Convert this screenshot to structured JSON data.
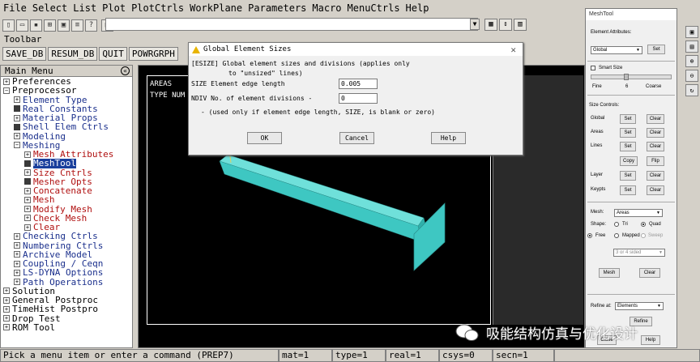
{
  "menubar": [
    "File",
    "Select",
    "List",
    "Plot",
    "PlotCtrls",
    "WorkPlane",
    "Parameters",
    "Macro",
    "MenuCtrls",
    "Help"
  ],
  "toolbar": {
    "label": "Toolbar",
    "buttons": [
      "SAVE_DB",
      "RESUM_DB",
      "QUIT",
      "POWRGRPH"
    ]
  },
  "main_menu": {
    "title": "Main Menu",
    "items": [
      {
        "label": "Preferences",
        "marker": "plus",
        "level": 0,
        "style": "black"
      },
      {
        "label": "Preprocessor",
        "marker": "minus",
        "level": 0,
        "style": "black"
      },
      {
        "label": "Element Type",
        "marker": "plus",
        "level": 1,
        "style": "blue"
      },
      {
        "label": "Real Constants",
        "marker": "block",
        "level": 1,
        "style": "blue"
      },
      {
        "label": "Material Props",
        "marker": "plus",
        "level": 1,
        "style": "blue"
      },
      {
        "label": "Shell Elem Ctrls",
        "marker": "block",
        "level": 1,
        "style": "blue"
      },
      {
        "label": "Modeling",
        "marker": "plus",
        "level": 1,
        "style": "blue"
      },
      {
        "label": "Meshing",
        "marker": "minus",
        "level": 1,
        "style": "blue"
      },
      {
        "label": "Mesh Attributes",
        "marker": "plus",
        "level": 2,
        "style": "red"
      },
      {
        "label": "MeshTool",
        "marker": "block",
        "level": 2,
        "style": "selected"
      },
      {
        "label": "Size Cntrls",
        "marker": "plus",
        "level": 2,
        "style": "red"
      },
      {
        "label": "Mesher Opts",
        "marker": "block",
        "level": 2,
        "style": "red"
      },
      {
        "label": "Concatenate",
        "marker": "plus",
        "level": 2,
        "style": "red"
      },
      {
        "label": "Mesh",
        "marker": "plus",
        "level": 2,
        "style": "red"
      },
      {
        "label": "Modify Mesh",
        "marker": "plus",
        "level": 2,
        "style": "red"
      },
      {
        "label": "Check Mesh",
        "marker": "plus",
        "level": 2,
        "style": "red"
      },
      {
        "label": "Clear",
        "marker": "plus",
        "level": 2,
        "style": "red"
      },
      {
        "label": "Checking Ctrls",
        "marker": "plus",
        "level": 1,
        "style": "blue"
      },
      {
        "label": "Numbering Ctrls",
        "marker": "plus",
        "level": 1,
        "style": "blue"
      },
      {
        "label": "Archive Model",
        "marker": "plus",
        "level": 1,
        "style": "blue"
      },
      {
        "label": "Coupling / Ceqn",
        "marker": "plus",
        "level": 1,
        "style": "blue"
      },
      {
        "label": "LS-DYNA Options",
        "marker": "plus",
        "level": 1,
        "style": "blue"
      },
      {
        "label": "Path Operations",
        "marker": "plus",
        "level": 1,
        "style": "blue"
      },
      {
        "label": "Solution",
        "marker": "plus",
        "level": 0,
        "style": "black"
      },
      {
        "label": "General Postproc",
        "marker": "plus",
        "level": 0,
        "style": "black"
      },
      {
        "label": "TimeHist Postpro",
        "marker": "plus",
        "level": 0,
        "style": "black"
      },
      {
        "label": "Drop Test",
        "marker": "plus",
        "level": 0,
        "style": "black"
      },
      {
        "label": "ROM Tool",
        "marker": "plus",
        "level": 0,
        "style": "black"
      }
    ]
  },
  "graphics": {
    "line1": "AREAS",
    "line2": "TYPE NUM",
    "model_color": "#3ec7c2"
  },
  "dialog": {
    "title": "Global Element Sizes",
    "desc1": "[ESIZE]  Global element sizes and divisions (applies only",
    "desc2": "to \"unsized\" lines)",
    "size_label": "SIZE  Element edge length",
    "size_value": "0.005",
    "ndiv_label": "NDIV  No. of element divisions -",
    "ndiv_value": "0",
    "note": "- (used only if element edge length, SIZE, is blank or zero)",
    "ok": "OK",
    "cancel": "Cancel",
    "help": "Help"
  },
  "meshtool": {
    "title": "MeshTool",
    "elem_attr_label": "Element Attributes:",
    "elem_attr_value": "Global",
    "set": "Set",
    "smart_size": "Smart Size",
    "fine": "Fine",
    "smart_level": "6",
    "coarse": "Coarse",
    "size_controls": "Size Controls:",
    "rows": [
      "Global",
      "Areas",
      "Lines",
      "Layer",
      "Keypts"
    ],
    "clear": "Clear",
    "copy": "Copy",
    "flip": "Flip",
    "mesh_label": "Mesh:",
    "mesh_value": "Areas",
    "shape_label": "Shape:",
    "tri": "Tri",
    "quad": "Quad",
    "free": "Free",
    "mapped": "Mapped",
    "sweep": "Sweep",
    "sided": "3 or 4 sided",
    "mesh_btn": "Mesh",
    "clear_btn": "Clear",
    "refine_at": "Refine at:",
    "refine_value": "Elements",
    "refine_btn": "Refine",
    "close": "Close",
    "help": "Help"
  },
  "right_edge_label": "I",
  "statusbar": {
    "prompt": "Pick a menu item or enter a command (PREP7)",
    "mat": "mat=1",
    "type": "type=1",
    "real": "real=1",
    "csys": "csys=0",
    "secn": "secn=1"
  },
  "watermark": "吸能结构仿真与优化设计"
}
